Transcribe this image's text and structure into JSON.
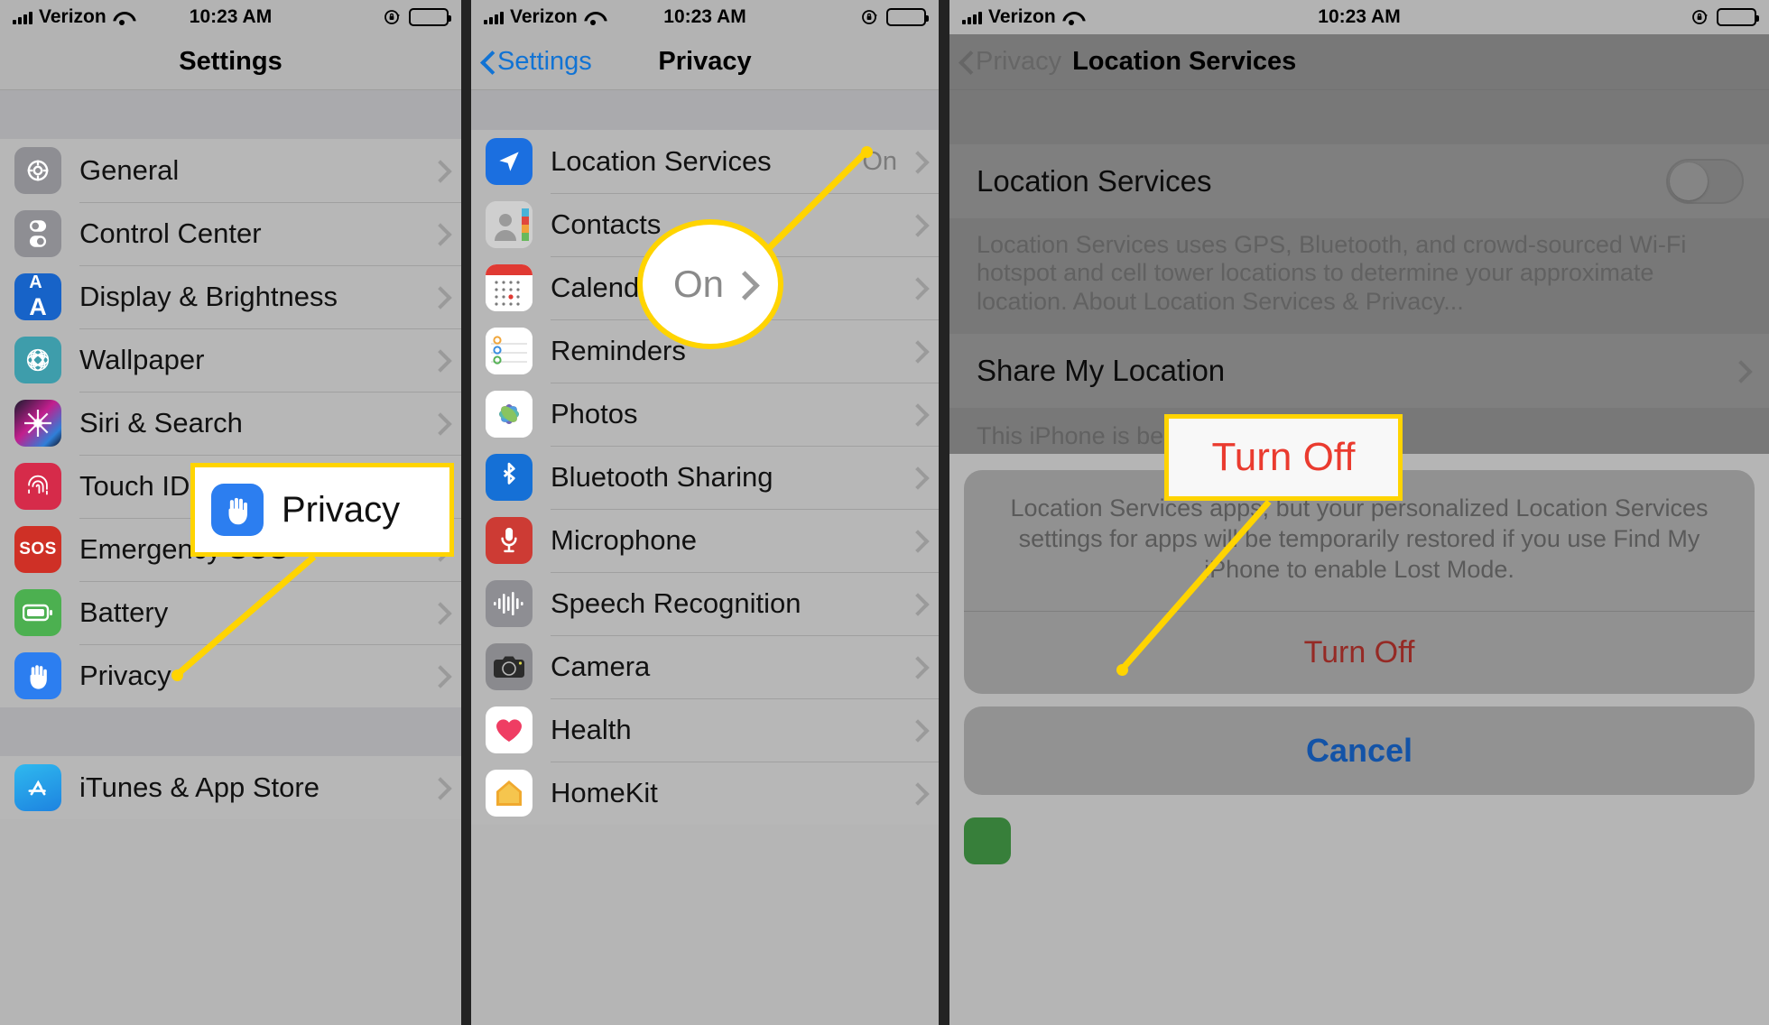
{
  "statusbar": {
    "carrier": "Verizon",
    "time": "10:23 AM",
    "signal_icon": "cellular-bars-icon",
    "wifi_icon": "wifi-icon",
    "orientation_lock_icon": "rotation-lock-icon",
    "battery_icon": "battery-icon"
  },
  "colors": {
    "accent_blue": "#1173d4",
    "destructive_red": "#cf3b33",
    "callout_yellow": "#ffd400",
    "panel_bg": "#b5b5b5"
  },
  "panel1": {
    "nav": {
      "title": "Settings"
    },
    "groups": [
      {
        "items": [
          {
            "label": "General",
            "icon": "gear-icon",
            "chevron": true
          },
          {
            "label": "Control Center",
            "icon": "control-center-icon",
            "chevron": true
          },
          {
            "label": "Display & Brightness",
            "icon": "display-aa-icon",
            "chevron": true
          },
          {
            "label": "Wallpaper",
            "icon": "wallpaper-icon",
            "chevron": true
          },
          {
            "label": "Siri & Search",
            "icon": "siri-icon",
            "chevron": true
          },
          {
            "label": "Touch ID & Passcode",
            "icon": "touch-id-icon",
            "chevron": true
          },
          {
            "label": "Emergency SOS",
            "icon": "sos-icon",
            "chevron": true
          },
          {
            "label": "Battery",
            "icon": "battery-app-icon",
            "chevron": true
          },
          {
            "label": "Privacy",
            "icon": "privacy-hand-icon",
            "chevron": true
          }
        ]
      },
      {
        "items": [
          {
            "label": "iTunes & App Store",
            "icon": "app-store-icon",
            "chevron": true
          }
        ]
      }
    ],
    "callout": {
      "label": "Privacy",
      "icon": "privacy-hand-icon"
    }
  },
  "panel2": {
    "nav": {
      "back_label": "Settings",
      "title": "Privacy"
    },
    "items": [
      {
        "label": "Location Services",
        "icon": "location-arrow-icon",
        "value": "On",
        "chevron": true
      },
      {
        "label": "Contacts",
        "icon": "contacts-icon",
        "value": "",
        "chevron": true
      },
      {
        "label": "Calendars",
        "icon": "calendar-icon",
        "value": "",
        "chevron": true
      },
      {
        "label": "Reminders",
        "icon": "reminders-icon",
        "value": "",
        "chevron": true
      },
      {
        "label": "Photos",
        "icon": "photos-icon",
        "value": "",
        "chevron": true
      },
      {
        "label": "Bluetooth Sharing",
        "icon": "bluetooth-icon",
        "value": "",
        "chevron": true
      },
      {
        "label": "Microphone",
        "icon": "microphone-icon",
        "value": "",
        "chevron": true
      },
      {
        "label": "Speech Recognition",
        "icon": "speech-waveform-icon",
        "value": "",
        "chevron": true
      },
      {
        "label": "Camera",
        "icon": "camera-icon",
        "value": "",
        "chevron": true
      },
      {
        "label": "Health",
        "icon": "health-heart-icon",
        "value": "",
        "chevron": true
      },
      {
        "label": "HomeKit",
        "icon": "homekit-house-icon",
        "value": "",
        "chevron": true
      }
    ],
    "callout": {
      "label": "On",
      "chevron_icon": "chevron-right-icon"
    }
  },
  "panel3": {
    "nav": {
      "back_label": "Privacy",
      "title": "Location Services"
    },
    "toggle_row": {
      "label": "Location Services",
      "state": "off"
    },
    "description": "Location Services uses GPS, Bluetooth, and crowd-sourced Wi-Fi hotspot and cell tower locations to determine your approximate location. About Location Services & Privacy...",
    "share_row": {
      "label": "Share My Location",
      "chevron": true
    },
    "share_footnote": "This iPhone is being u",
    "sheet": {
      "message": "Location Services apps, but your personalized Location Services settings for apps will be temporarily restored if you use Find My iPhone to enable Lost Mode.",
      "confirm_label": "Turn Off",
      "cancel_label": "Cancel"
    },
    "callout": {
      "label": "Turn Off"
    }
  }
}
